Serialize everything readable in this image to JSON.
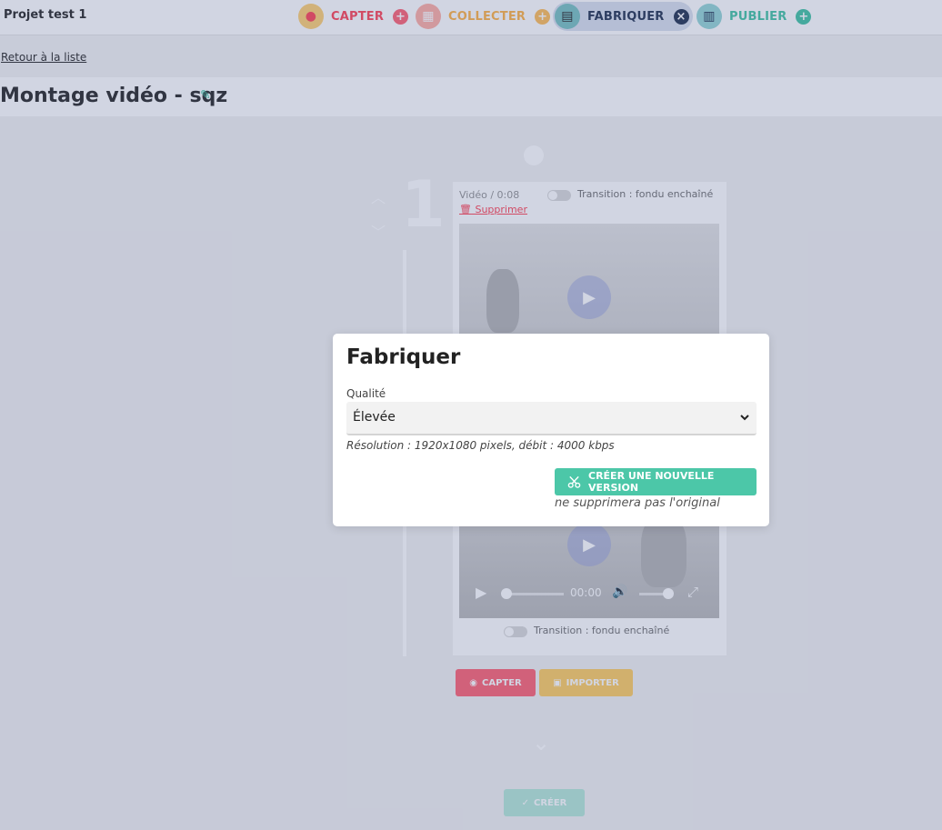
{
  "header": {
    "project_name": "Projet test 1",
    "steps": {
      "capter": {
        "label": "CAPTER",
        "action": "+"
      },
      "collecter": {
        "label": "COLLECTER",
        "action": "+"
      },
      "fabriquer": {
        "label": "FABRIQUER",
        "action": "×"
      },
      "publier": {
        "label": "PUBLIER",
        "action": "+"
      }
    }
  },
  "nav": {
    "back_link": "Retour à la liste"
  },
  "page": {
    "title": "Montage vidéo - sqz"
  },
  "timeline": {
    "media_number": "1",
    "media": {
      "meta": "Vidéo / 0:08",
      "transition_label": "Transition : fondu enchaîné",
      "delete_label": "Supprimer",
      "player_time": "00:00"
    },
    "buttons": {
      "capter": "CAPTER",
      "importer": "IMPORTER",
      "creer": "CRÉER"
    }
  },
  "modal": {
    "title": "Fabriquer",
    "quality_label": "Qualité",
    "quality_value": "Élevée",
    "resolution_info": "Résolution : 1920x1080 pixels, débit : 4000 kbps",
    "create_button": "CRÉER UNE NOUVELLE VERSION",
    "note": "ne supprimera pas l'original"
  },
  "colors": {
    "accent_green": "#4cc7a8",
    "capter_red": "#ff4d5e",
    "collecter_orange": "#ffb74d",
    "overlay": "rgba(46,62,122,0.22)"
  }
}
